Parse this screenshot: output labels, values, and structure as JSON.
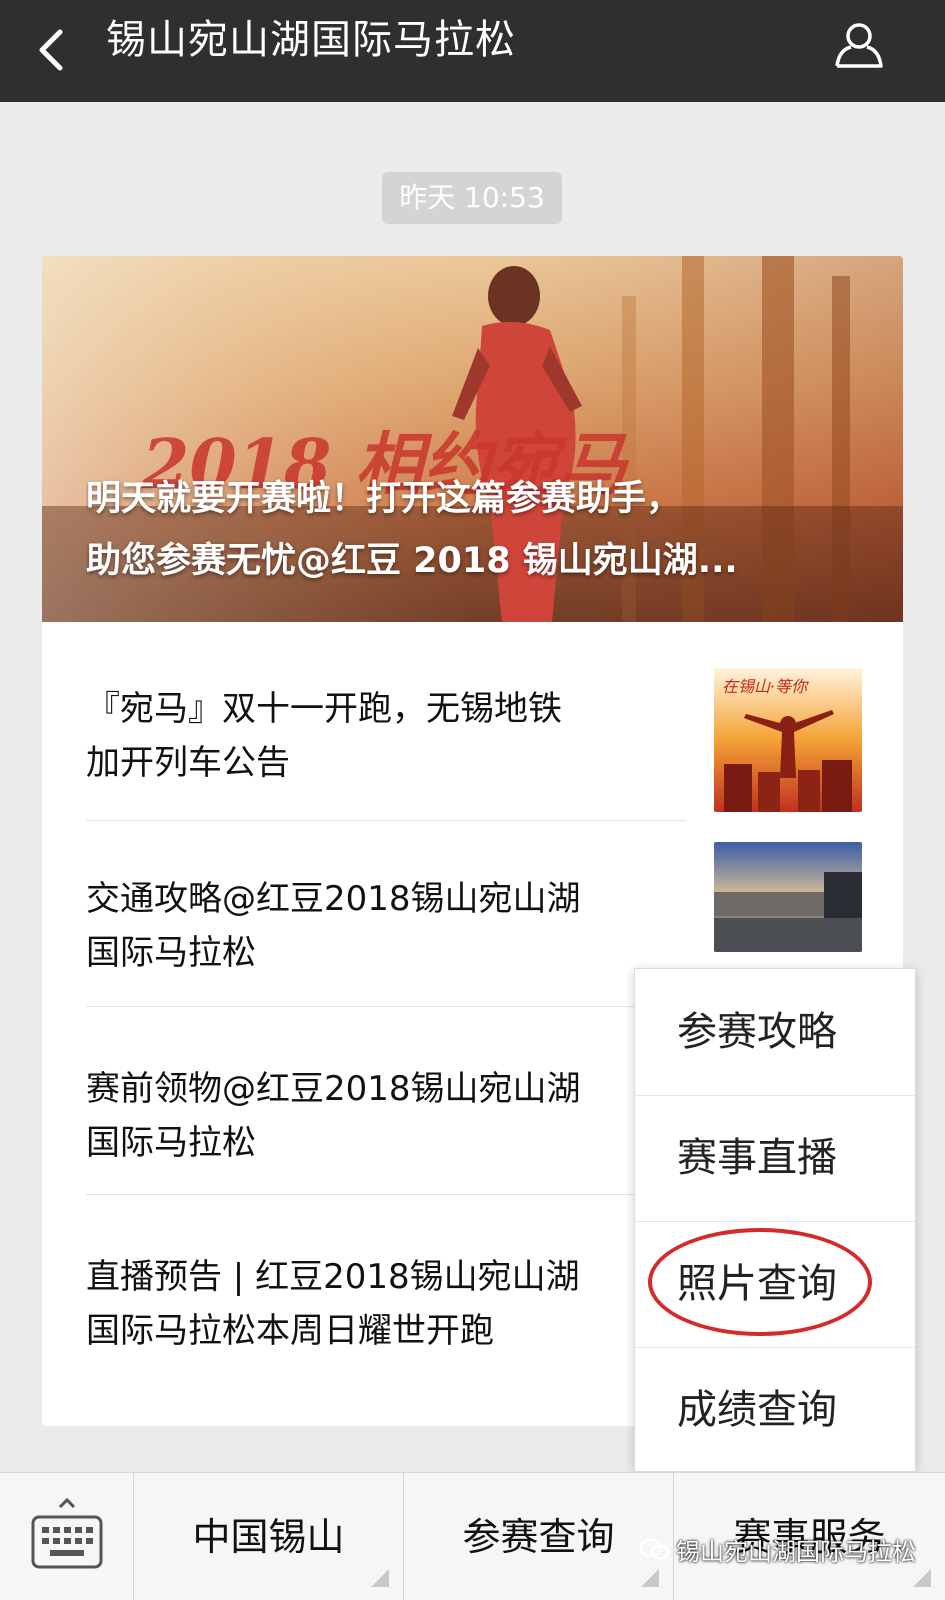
{
  "header": {
    "title": "锡山宛山湖国际马拉松"
  },
  "timestamp": "昨天 10:53",
  "article": {
    "headline_line1": "明天就要开赛啦！打开这篇参赛助手，",
    "headline_line2": "助您参赛无忧@红豆 2018 锡山宛山湖...",
    "hero_overlay_text": "2018 相约宛马",
    "items": [
      {
        "line1": "『宛马』双十一开跑，无锡地铁",
        "line2": "加开列车公告"
      },
      {
        "line1": "交通攻略@红豆2018锡山宛山湖",
        "line2": "国际马拉松"
      },
      {
        "line1": "赛前领物@红豆2018锡山宛山湖",
        "line2": "国际马拉松"
      },
      {
        "line1": "直播预告 | 红豆2018锡山宛山湖",
        "line2": "国际马拉松本周日耀世开跑"
      }
    ],
    "thumb1_caption": "在锡山·等你"
  },
  "popup_menu": {
    "items": [
      "参赛攻略",
      "赛事直播",
      "照片查询",
      "成绩查询"
    ],
    "highlighted": "照片查询",
    "highlight_color": "#d42a2a"
  },
  "bottom_menu": {
    "tabs": [
      "中国锡山",
      "参赛查询",
      "赛事服务"
    ]
  },
  "watermark": "锡山宛山湖国际马拉松",
  "colors": {
    "header_bg": "#2f2f30",
    "page_bg": "#ebebeb"
  }
}
